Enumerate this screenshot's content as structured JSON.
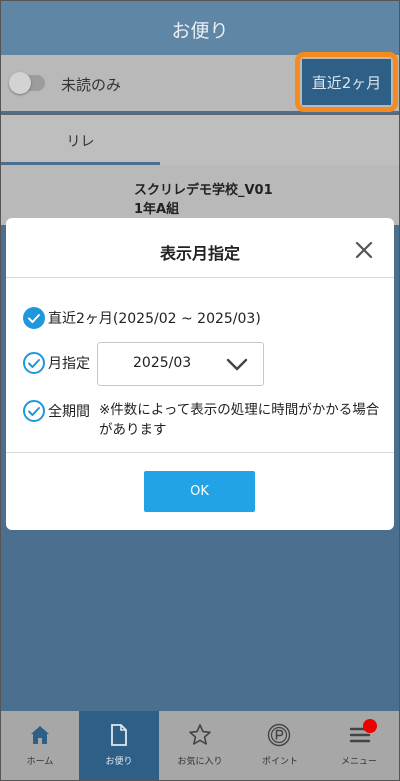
{
  "header": {
    "title": "お便り"
  },
  "filter": {
    "unread_only_label": "未読のみ",
    "period_button_label": "直近2ヶ月"
  },
  "tabs": [
    {
      "label": "リレ"
    }
  ],
  "list": {
    "items": [
      {
        "school": "スクリレデモ学校_V01",
        "class": "1年A組"
      }
    ]
  },
  "dialog": {
    "title": "表示月指定",
    "options": [
      {
        "label": "直近2ヶ月(2025/02 ~ 2025/03)",
        "checked": true
      },
      {
        "label": "月指定",
        "checked": false
      },
      {
        "label": "全期間",
        "checked": false
      }
    ],
    "month_select_value": "2025/03",
    "all_period_note": "※件数によって表示の処理に時間がかかる場合があります",
    "ok_label": "OK"
  },
  "bottom_nav": {
    "items": [
      {
        "label": "ホーム",
        "icon": "home-icon"
      },
      {
        "label": "お便り",
        "icon": "document-icon",
        "active": true
      },
      {
        "label": "お気に入り",
        "icon": "star-icon"
      },
      {
        "label": "ポイント",
        "icon": "points-icon"
      },
      {
        "label": "メニュー",
        "icon": "menu-icon",
        "badge": true
      }
    ]
  },
  "colors": {
    "accent": "#1e97dc",
    "highlight": "#f58a1f",
    "badge": "#ee0000"
  }
}
